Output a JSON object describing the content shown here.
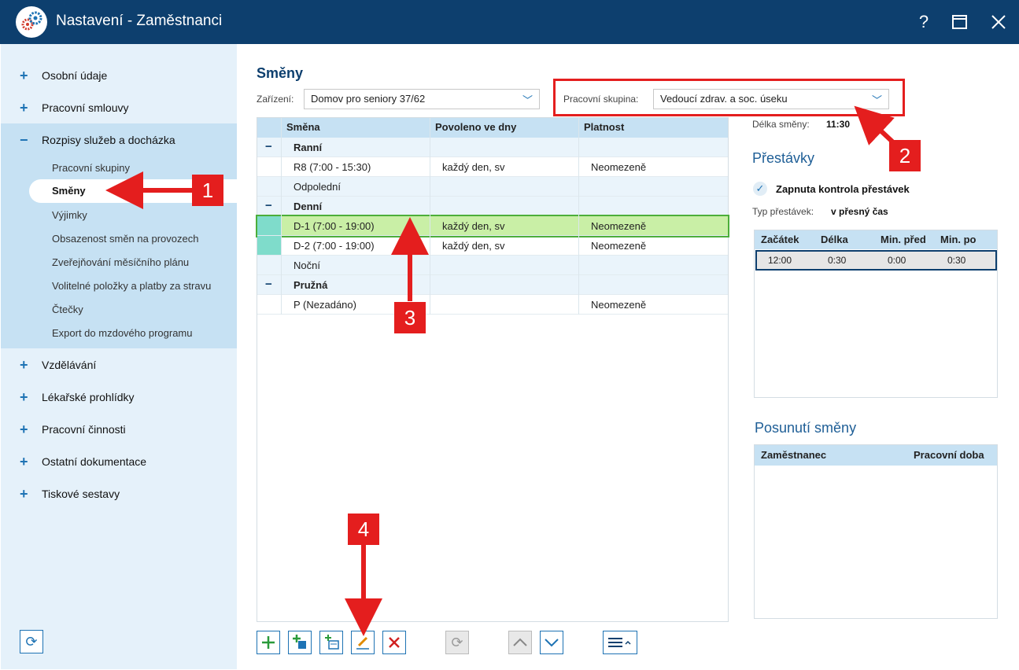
{
  "window": {
    "title": "Nastavení - Zaměstnanci",
    "buttons": {
      "help": "?",
      "maximize": "☐",
      "close": "✕"
    }
  },
  "sidebar": {
    "items": [
      {
        "label": "Osobní údaje",
        "expanded": false
      },
      {
        "label": "Pracovní smlouvy",
        "expanded": false
      },
      {
        "label": "Rozpisy služeb a docházka",
        "expanded": true
      },
      {
        "label": "Vzdělávání",
        "expanded": false
      },
      {
        "label": "Lékařské prohlídky",
        "expanded": false
      },
      {
        "label": "Pracovní činnosti",
        "expanded": false
      },
      {
        "label": "Ostatní dokumentace",
        "expanded": false
      },
      {
        "label": "Tiskové sestavy",
        "expanded": false
      }
    ],
    "subitems": [
      "Pracovní skupiny",
      "Směny",
      "Výjimky",
      "Obsazenost směn na provozech",
      "Zveřejňování měsíčního plánu",
      "Volitelné položky a platby za stravu",
      "Čtečky",
      "Export do mzdového programu"
    ],
    "active_subitem": "Směny"
  },
  "main": {
    "heading": "Směny",
    "facility_label": "Zařízení:",
    "facility_value": "Domov pro seniory 37/62",
    "workgroup_label": "Pracovní skupina:",
    "workgroup_value": "Vedoucí zdrav. a soc. úseku",
    "columns": [
      "Směna",
      "Povoleno ve dny",
      "Platnost"
    ],
    "rows": [
      {
        "type": "group",
        "name": "Ranní",
        "collapsible": true
      },
      {
        "type": "item",
        "name": "R8 (7:00 - 15:30)",
        "days": "každý den, sv",
        "validity": "Neomezeně"
      },
      {
        "type": "group",
        "name": "Odpolední",
        "collapsible": false
      },
      {
        "type": "group",
        "name": "Denní",
        "collapsible": true
      },
      {
        "type": "item",
        "name": "D-1 (7:00 - 19:00)",
        "days": "každý den, sv",
        "validity": "Neomezeně",
        "selected": true,
        "color": "#7fdccb"
      },
      {
        "type": "item",
        "name": "D-2 (7:00 - 19:00)",
        "days": "každý den, sv",
        "validity": "Neomezeně",
        "color": "#7fdccb"
      },
      {
        "type": "group",
        "name": "Noční",
        "collapsible": false
      },
      {
        "type": "group",
        "name": "Pružná",
        "collapsible": true
      },
      {
        "type": "item",
        "name": "P (Nezadáno)",
        "days": "",
        "validity": "Neomezeně"
      }
    ],
    "group_toggle_symbol": "−"
  },
  "toolbar": {
    "add": "+",
    "refresh": "⟳",
    "up": "︿",
    "down": "﹀",
    "delete": "✕",
    "menu": "≡˄"
  },
  "right": {
    "shift_length_label": "Délka směny:",
    "shift_length_value": "11:30",
    "breaks_title": "Přestávky",
    "breaks_check_label": "Zapnuta kontrola přestávek",
    "breaks_check_mark": "✓",
    "break_type_label": "Typ přestávek:",
    "break_type_value": "v přesný čas",
    "breaks_columns": [
      "Začátek",
      "Délka",
      "Min. před",
      "Min. po"
    ],
    "breaks_rows": [
      {
        "start": "12:00",
        "length": "0:30",
        "min_before": "0:00",
        "min_after": "0:30"
      }
    ],
    "shift_move_title": "Posunutí směny",
    "shift_move_columns": [
      "Zaměstnanec",
      "Pracovní doba"
    ]
  },
  "annotations": [
    "1",
    "2",
    "3",
    "4"
  ],
  "colors": {
    "titlebar": "#0d3f6e",
    "accent": "#1e73b4",
    "annotation": "#e41e1e",
    "selected_row": "#c9efa6",
    "swatch": "#7fdccb"
  },
  "icons": [
    "app-gears-icon",
    "help-icon",
    "maximize-icon",
    "close-icon",
    "plus-icon",
    "minus-icon",
    "refresh-icon",
    "add-icon",
    "copy-add-icon",
    "add-calendar-icon",
    "edit-icon",
    "delete-icon",
    "restore-icon",
    "arrow-up-icon",
    "arrow-down-icon",
    "menu-icon",
    "chevron-down-icon",
    "check-icon"
  ]
}
